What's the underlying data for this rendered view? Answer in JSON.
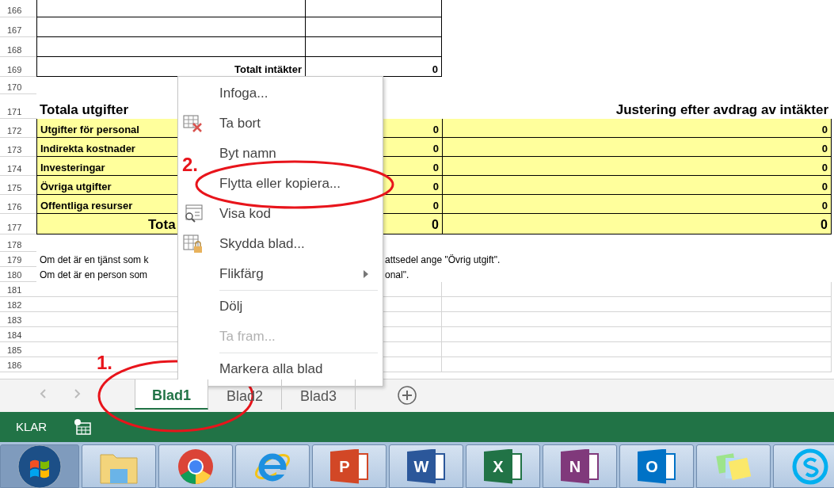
{
  "sheet": {
    "rows": [
      {
        "number": "166",
        "kind": "box"
      },
      {
        "number": "167",
        "kind": "box"
      },
      {
        "number": "168",
        "kind": "box"
      },
      {
        "number": "169",
        "kind": "box",
        "cells": {
          "a": "Totalt intäkter",
          "b": "0"
        }
      },
      {
        "number": "170",
        "kind": "empty"
      },
      {
        "number": "171",
        "kind": "heading",
        "cells": {
          "a": "Totala utgifter",
          "c": "Justering efter avdrag av intäkter"
        }
      },
      {
        "number": "172",
        "kind": "item",
        "cells": {
          "a": "Utgifter för personal",
          "b": "0",
          "c": "0"
        }
      },
      {
        "number": "173",
        "kind": "item",
        "cells": {
          "a": "Indirekta kostnader",
          "b": "0",
          "c": "0"
        }
      },
      {
        "number": "174",
        "kind": "item",
        "cells": {
          "a": "Investeringar",
          "b": "0",
          "c": "0"
        }
      },
      {
        "number": "175",
        "kind": "item",
        "cells": {
          "a": "Övriga utgifter",
          "b": "0",
          "c": "0"
        }
      },
      {
        "number": "176",
        "kind": "item",
        "cells": {
          "a": "Offentliga resurser",
          "b": "0",
          "c": "0"
        }
      },
      {
        "number": "177",
        "kind": "total",
        "cells": {
          "a": "Tota",
          "b": "0",
          "c": "0"
        }
      },
      {
        "number": "178",
        "kind": "empty"
      },
      {
        "number": "179",
        "kind": "note",
        "cells": {
          "a": "Om det är en tjänst som k",
          "b": "attsedel ange \"Övrig utgift\"."
        }
      },
      {
        "number": "180",
        "kind": "note",
        "cells": {
          "a": "Om det är en person som",
          "b": "onal\"."
        }
      },
      {
        "number": "181",
        "kind": "blank"
      },
      {
        "number": "182",
        "kind": "blank"
      },
      {
        "number": "183",
        "kind": "blank"
      },
      {
        "number": "184",
        "kind": "blank"
      },
      {
        "number": "185",
        "kind": "blank"
      },
      {
        "number": "186",
        "kind": "blank"
      }
    ]
  },
  "context_menu": [
    {
      "kind": "item",
      "label": "Infoga...",
      "disabled": false
    },
    {
      "kind": "delete",
      "label": "Ta bort",
      "disabled": false
    },
    {
      "kind": "item",
      "label": "Byt namn",
      "disabled": false
    },
    {
      "kind": "item",
      "label": "Flytta eller kopiera...",
      "disabled": false
    },
    {
      "kind": "code",
      "label": "Visa kod",
      "disabled": false
    },
    {
      "kind": "protect",
      "label": "Skydda blad...",
      "disabled": false
    },
    {
      "kind": "submenu",
      "label": "Flikfärg",
      "disabled": false
    },
    {
      "kind": "separator"
    },
    {
      "kind": "item",
      "label": "Dölj",
      "disabled": false
    },
    {
      "kind": "item",
      "label": "Ta fram...",
      "disabled": true
    },
    {
      "kind": "separator"
    },
    {
      "kind": "item",
      "label": "Markera alla blad",
      "disabled": false
    }
  ],
  "sheet_tabs": [
    {
      "label": "Blad1",
      "selected": true
    },
    {
      "label": "Blad2",
      "selected": false
    },
    {
      "label": "Blad3",
      "selected": false
    }
  ],
  "status_bar": {
    "text": "KLAR"
  },
  "annotations": [
    {
      "label": "2."
    },
    {
      "label": "1."
    }
  ],
  "taskbar": [
    {
      "kind": "start"
    },
    {
      "kind": "folder"
    },
    {
      "kind": "chrome"
    },
    {
      "kind": "ie"
    },
    {
      "kind": "office",
      "letter": "P",
      "color": "#d24726"
    },
    {
      "kind": "office",
      "letter": "W",
      "color": "#2b579a"
    },
    {
      "kind": "office",
      "letter": "X",
      "color": "#217346"
    },
    {
      "kind": "office",
      "letter": "N",
      "color": "#80397b"
    },
    {
      "kind": "office",
      "letter": "O",
      "color": "#0072c6"
    },
    {
      "kind": "notes"
    },
    {
      "kind": "skype"
    }
  ]
}
